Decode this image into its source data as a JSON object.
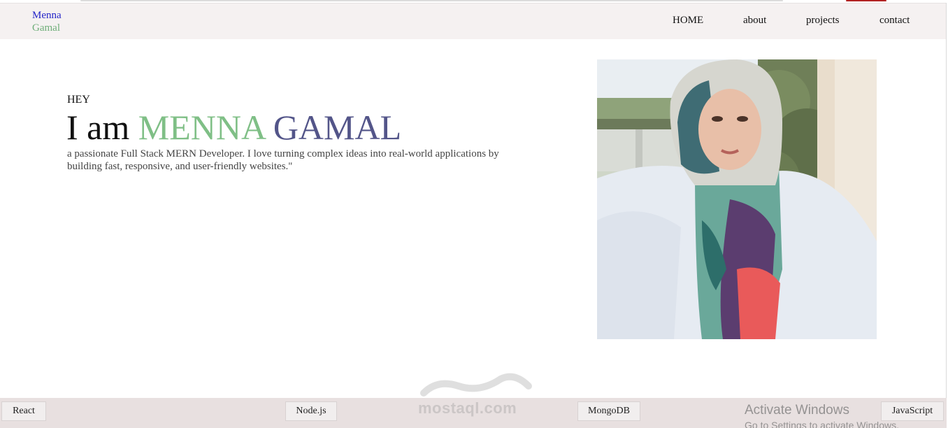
{
  "header": {
    "logo_first": "Menna",
    "logo_last": "Gamal",
    "nav": [
      {
        "label": "HOME"
      },
      {
        "label": "about"
      },
      {
        "label": "projects"
      },
      {
        "label": "contact"
      }
    ]
  },
  "hero": {
    "greeting": "HEY",
    "intro": "I am",
    "first_name": "MENNA",
    "last_name": "GAMAL",
    "description": "a passionate Full Stack MERN Developer. I love turning complex ideas into real-world applications by building fast, responsive, and user-friendly websites.\""
  },
  "skills": [
    {
      "label": "React"
    },
    {
      "label": "Node.js"
    },
    {
      "label": "MongoDB"
    },
    {
      "label": "JavaScript"
    }
  ],
  "watermark": {
    "site": "mostaql.com"
  },
  "system_overlay": {
    "title": "Activate Windows",
    "subtitle": "Go to Settings to activate Windows."
  },
  "colors": {
    "header_bg": "#f5f1f1",
    "logo_first": "#2323c8",
    "logo_last": "#6fae79",
    "first_name": "#7fbf86",
    "last_name": "#535589",
    "footer_bg": "#e8e0e0"
  }
}
